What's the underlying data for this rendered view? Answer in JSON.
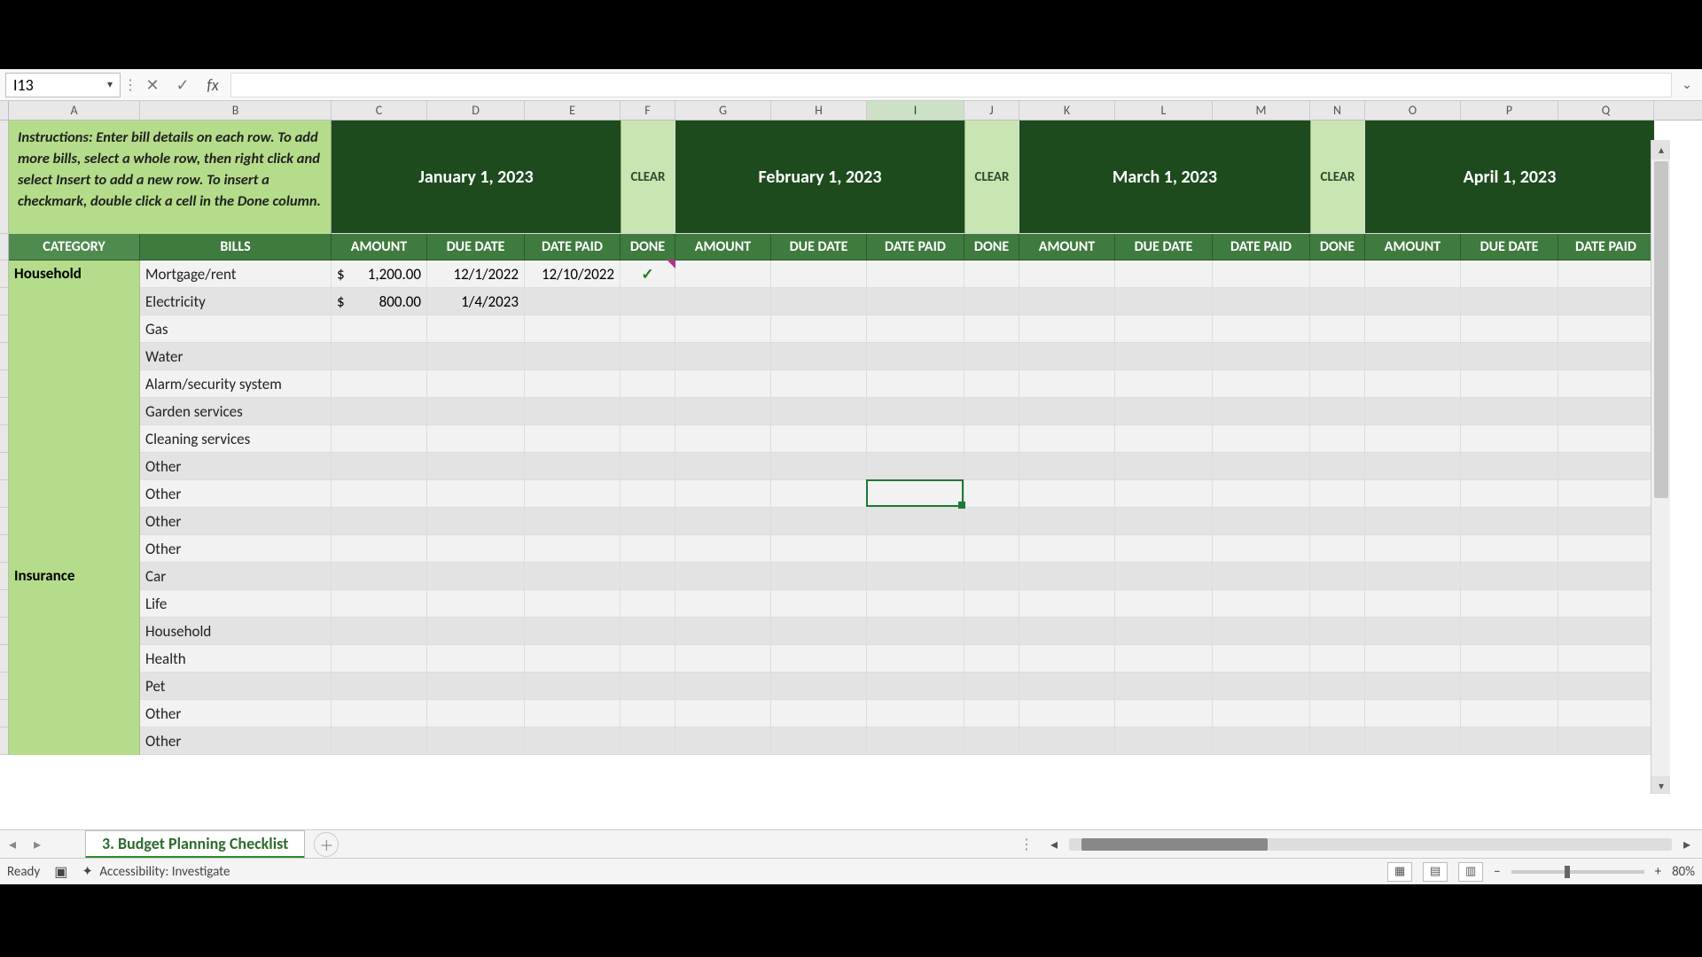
{
  "formula_bar": {
    "cell_ref": "I13",
    "formula": ""
  },
  "columns": [
    "A",
    "B",
    "C",
    "D",
    "E",
    "F",
    "G",
    "H",
    "I",
    "J",
    "K",
    "L",
    "M",
    "N",
    "O",
    "P",
    "Q"
  ],
  "selected_column": "I",
  "instructions": "Instructions: Enter bill details on each row. To add more bills, select a whole row, then right click and select Insert to add a new row. To insert a checkmark, double click a cell in the Done column.",
  "month_headers": [
    {
      "label": "January 1, 2023",
      "clear": "CLEAR"
    },
    {
      "label": "February 1, 2023",
      "clear": "CLEAR"
    },
    {
      "label": "March 1, 2023",
      "clear": "CLEAR"
    },
    {
      "label": "April 1, 2023",
      "clear": ""
    }
  ],
  "table_headers": {
    "category": "CATEGORY",
    "bills": "BILLS",
    "amount": "AMOUNT",
    "due": "DUE DATE",
    "paid": "DATE PAID",
    "done": "DONE"
  },
  "groups": [
    {
      "category": "Household",
      "rows": [
        {
          "bill": "Mortgage/rent",
          "amount": "1,200.00",
          "due": "12/1/2022",
          "paid": "12/10/2022",
          "done": true
        },
        {
          "bill": "Electricity",
          "amount": "800.00",
          "due": "1/4/2023",
          "paid": "",
          "done": false
        },
        {
          "bill": "Gas"
        },
        {
          "bill": "Water"
        },
        {
          "bill": "Alarm/security system"
        },
        {
          "bill": "Garden services"
        },
        {
          "bill": "Cleaning services"
        },
        {
          "bill": "Other"
        },
        {
          "bill": "Other"
        },
        {
          "bill": "Other"
        },
        {
          "bill": "Other"
        }
      ]
    },
    {
      "category": "Insurance",
      "rows": [
        {
          "bill": "Car"
        },
        {
          "bill": "Life"
        },
        {
          "bill": "Household"
        },
        {
          "bill": "Health"
        },
        {
          "bill": "Pet"
        },
        {
          "bill": "Other"
        },
        {
          "bill": "Other"
        }
      ]
    }
  ],
  "currency": "$",
  "checkmark": "✓",
  "sheet_tab": "3. Budget Planning Checklist",
  "status": {
    "ready": "Ready",
    "accessibility": "Accessibility: Investigate",
    "zoom": "80%"
  },
  "selection": {
    "col": "I",
    "row_index_in_data": 8
  }
}
